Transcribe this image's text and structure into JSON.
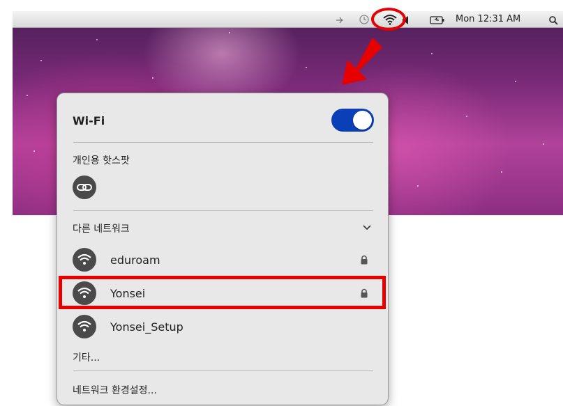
{
  "menubar": {
    "clock": "Mon 12:31 AM"
  },
  "popup": {
    "wifi_title": "Wi-Fi",
    "wifi_enabled": true,
    "hotspot_section": "개인용 핫스팟",
    "other_networks_section": "다른 네트워크",
    "networks": [
      {
        "name": "eduroam",
        "locked": true
      },
      {
        "name": "Yonsei",
        "locked": true
      },
      {
        "name": "Yonsei_Setup",
        "locked": false
      }
    ],
    "other": "기타...",
    "network_settings": "네트워크 환경설정..."
  },
  "colors": {
    "annotation_red": "#e60000",
    "toggle_on": "#0b3fb8"
  },
  "icons": [
    "wifi-icon",
    "link-icon",
    "lock-icon",
    "chevron-down-icon",
    "search-icon",
    "battery-icon",
    "volume-icon",
    "time-machine-icon",
    "bluetooth-icon"
  ]
}
